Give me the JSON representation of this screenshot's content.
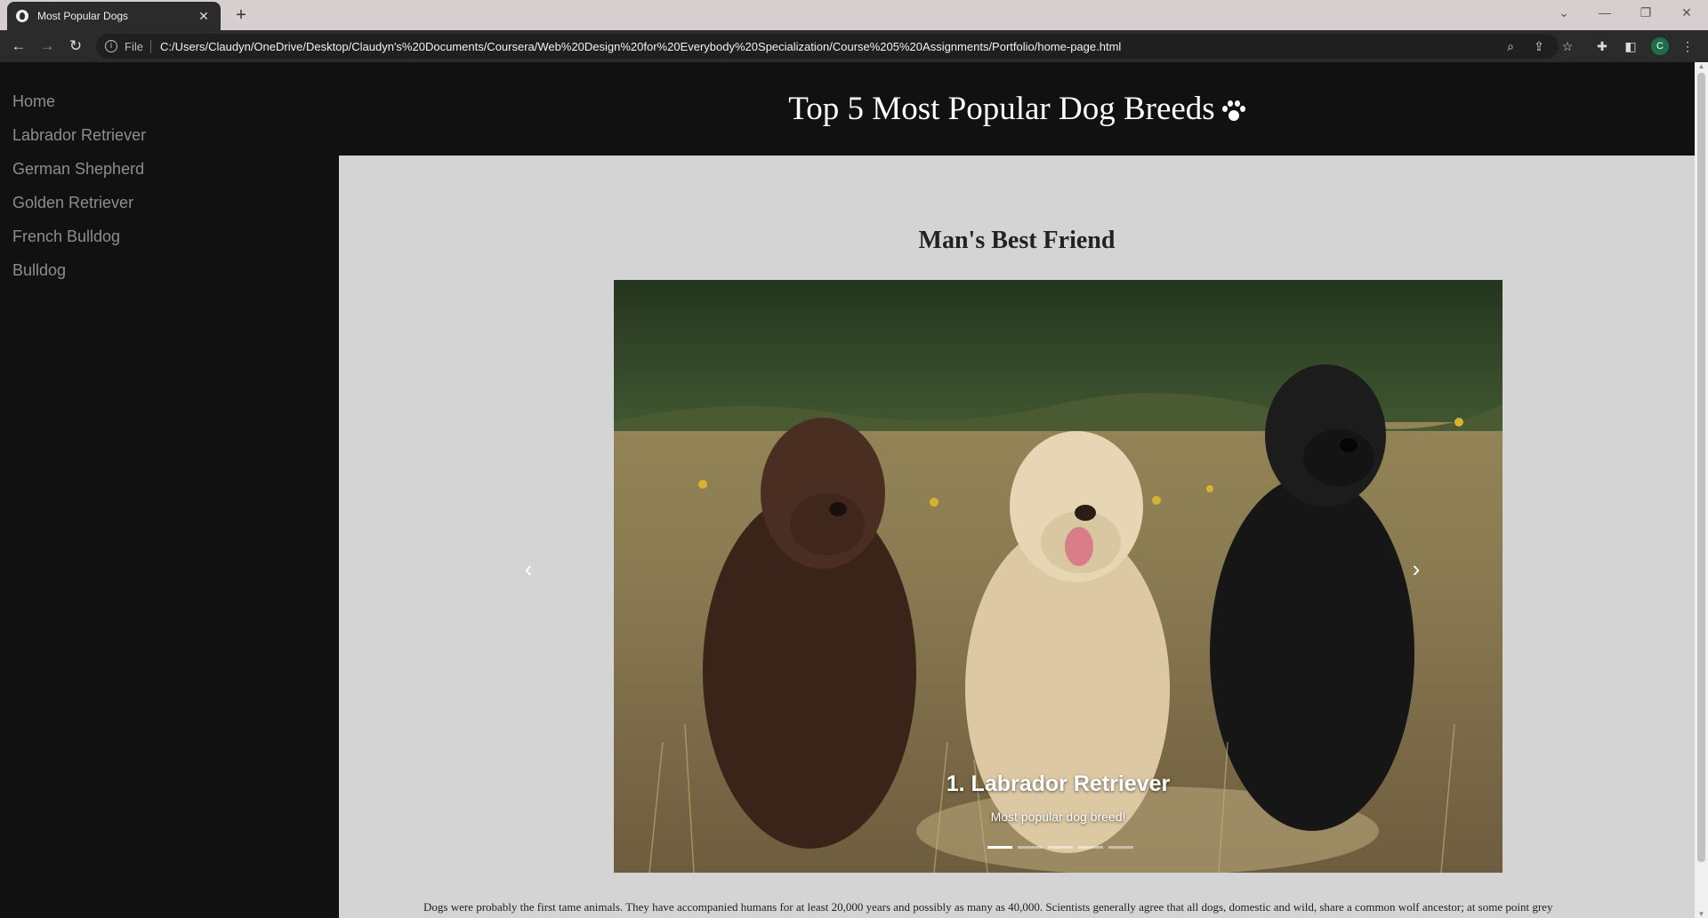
{
  "browser": {
    "tab_title": "Most Popular Dogs",
    "tab_close": "✕",
    "new_tab": "+",
    "file_label": "File",
    "url": "C:/Users/Claudyn/OneDrive/Desktop/Claudyn's%20Documents/Coursera/Web%20Design%20for%20Everybody%20Specialization/Course%205%20Assignments/Portfolio/home-page.html",
    "profile_initial": "C"
  },
  "sidebar": {
    "items": [
      {
        "label": "Home"
      },
      {
        "label": "Labrador Retriever"
      },
      {
        "label": "German Shepherd"
      },
      {
        "label": "Golden Retriever"
      },
      {
        "label": "French Bulldog"
      },
      {
        "label": "Bulldog"
      }
    ]
  },
  "header": {
    "title": "Top 5 Most Popular Dog Breeds",
    "icon": "paw-icon"
  },
  "main": {
    "heading": "Man's Best Friend",
    "carousel": {
      "caption_title": "1. Labrador Retriever",
      "caption_text": "Most popular dog breed!",
      "slide_count": 5,
      "active_index": 0,
      "prev_icon": "‹",
      "next_icon": "›"
    },
    "paragraph": "Dogs were probably the first tame animals. They have accompanied humans for at least 20,000 years and possibly as many as 40,000. Scientists generally agree that all dogs, domestic and wild, share a common wolf ancestor; at some point grey"
  },
  "colors": {
    "sidebar_bg": "#111111",
    "content_bg": "#d4d4d4",
    "nav_text": "#8d8d8d"
  }
}
